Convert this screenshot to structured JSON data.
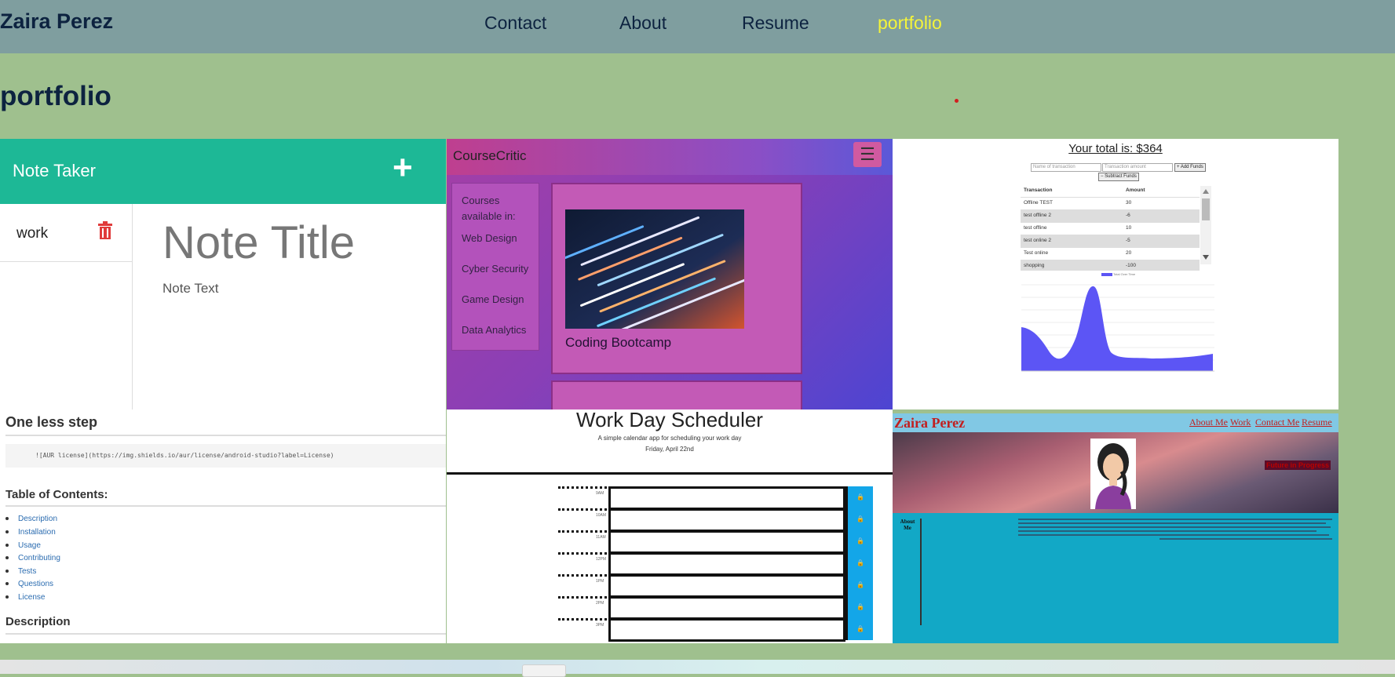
{
  "header": {
    "brand": "Zaira Perez",
    "nav": [
      {
        "label": "Contact"
      },
      {
        "label": "About"
      },
      {
        "label": "Resume"
      },
      {
        "label": "portfolio",
        "active": true
      }
    ]
  },
  "page": {
    "heading": "portfolio"
  },
  "colors": {
    "accent_active_nav": "#f4f43a",
    "header_bg": "#7f9e9f",
    "page_bg": "#9fc08e",
    "note_taker_teal": "#1db896"
  },
  "projects": {
    "note_taker": {
      "app_title": "Note Taker",
      "add_icon": "plus-icon",
      "note_item": "work",
      "delete_icon": "trash-icon",
      "note_title": "Note Title",
      "note_text": "Note Text"
    },
    "course_critic": {
      "brand": "CourseCritic",
      "menu_icon": "hamburger-icon",
      "sidebar": [
        "Courses available in:",
        "Web Design",
        "Cyber Security",
        "Game Design",
        "Data Analytics"
      ],
      "card_caption": "Coding Bootcamp"
    },
    "budget": {
      "title": "Your total is: $364",
      "name_placeholder": "Name of transaction",
      "amount_placeholder": "Transaction amount",
      "add_button": "+ Add Funds",
      "subtract_button": "− Subtract Funds",
      "columns": [
        "Transaction",
        "Amount"
      ],
      "rows": [
        [
          "Offline TEST",
          "30"
        ],
        [
          "test offline 2",
          "-6"
        ],
        [
          "test offline",
          "10"
        ],
        [
          "test online 2",
          "-5"
        ],
        [
          "Test online",
          "20"
        ],
        [
          "shopping",
          "-100"
        ]
      ],
      "legend": "Total Over Time"
    },
    "readme": {
      "heading": "One less step",
      "code": "![AUR license](https://img.shields.io/aur/license/android-studio?label=License)",
      "toc_heading": "Table of Contents:",
      "toc": [
        "Description",
        "Installation",
        "Usage",
        "Contributing",
        "Tests",
        "Questions",
        "License"
      ],
      "section_heading": "Description"
    },
    "scheduler": {
      "title": "Work Day Scheduler",
      "subtitle": "A simple calendar app for scheduling your work day",
      "date": "Friday, April 22nd",
      "hours": [
        "9AM",
        "10AM",
        "11AM",
        "12PM",
        "1PM",
        "2PM",
        "3PM"
      ]
    },
    "personal_site": {
      "brand": "Zaira Perez",
      "links": [
        "About Me",
        "Work",
        "Contact Me",
        "Resume"
      ],
      "banner": "Future in Progress",
      "section": "About Me"
    }
  }
}
